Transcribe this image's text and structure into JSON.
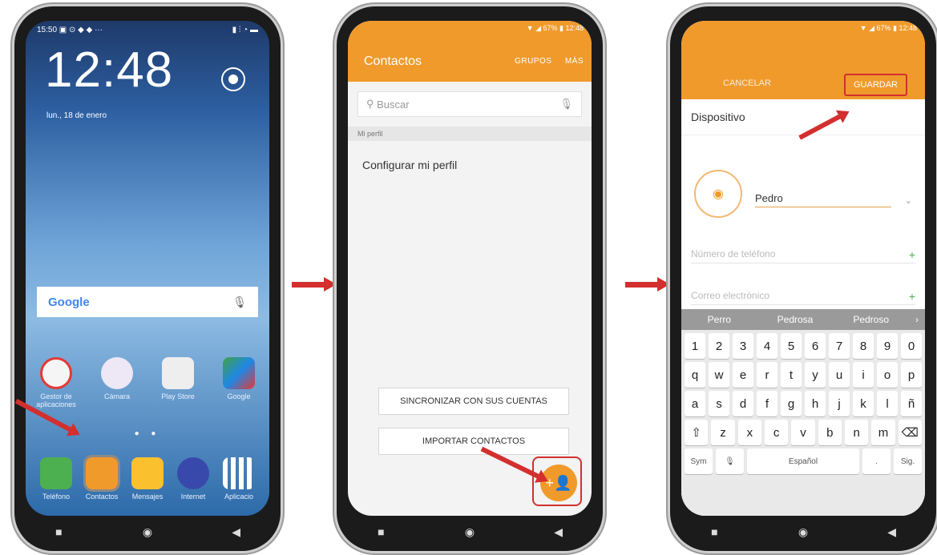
{
  "phone1": {
    "status_left": "15:50 ▣ ⊙ ◆ ◆ ···",
    "status_right": "▮ ⫶ ◔ ▬",
    "clock": "12:48",
    "date": "lun., 18 de enero",
    "search_brand": "Google",
    "apps_row1": [
      {
        "label": "Gestor de aplicaciones",
        "icon": "settings-red-icon",
        "color": "#e53935"
      },
      {
        "label": "Cámara",
        "icon": "camera-icon",
        "color": "#7e57c2"
      },
      {
        "label": "Play Store",
        "icon": "play-store-icon",
        "color": "#e0e0e0"
      },
      {
        "label": "Google",
        "icon": "google-folder-icon",
        "color": "#43a047"
      }
    ],
    "apps_row2": [
      {
        "label": "Teléfono",
        "icon": "phone-icon",
        "color": "#4caf50"
      },
      {
        "label": "Contactos",
        "icon": "contacts-icon",
        "color": "#f09a2c"
      },
      {
        "label": "Mensajes",
        "icon": "messages-icon",
        "color": "#fbc02d"
      },
      {
        "label": "Internet",
        "icon": "internet-icon",
        "color": "#3949ab"
      },
      {
        "label": "Aplicacio",
        "icon": "apps-grid-icon",
        "color": "#ffffff"
      }
    ]
  },
  "phone2": {
    "status": "▼ ◢ 67% ▮ 12:48",
    "title": "Contactos",
    "action_groups": "GRUPOS",
    "action_more": "MÁS",
    "search_placeholder": "Buscar",
    "section_label": "Mi perfil",
    "profile_row": "Configurar mi perfil",
    "sync_button": "SINCRONIZAR CON SUS CUENTAS",
    "import_button": "IMPORTAR CONTACTOS"
  },
  "phone3": {
    "status": "▼ ◢ 67% ▮ 12:48",
    "cancel": "CANCELAR",
    "save": "GUARDAR",
    "device_label": "Dispositivo",
    "name_value": "Pedro",
    "phone_placeholder": "Número de teléfono",
    "email_placeholder": "Correo electrónico",
    "suggestions": [
      "Perro",
      "Pedrosa",
      "Pedroso",
      "›"
    ],
    "keys_numbers": [
      "1",
      "2",
      "3",
      "4",
      "5",
      "6",
      "7",
      "8",
      "9",
      "0"
    ],
    "keys_row1": [
      "q",
      "w",
      "e",
      "r",
      "t",
      "y",
      "u",
      "i",
      "o",
      "p"
    ],
    "keys_row2": [
      "a",
      "s",
      "d",
      "f",
      "g",
      "h",
      "j",
      "k",
      "l",
      "ñ"
    ],
    "keys_row3": [
      "⇧",
      "z",
      "x",
      "c",
      "v",
      "b",
      "n",
      "m",
      "⌫"
    ],
    "key_sym": "Sym",
    "key_space": "Español",
    "key_next": "Sig."
  },
  "colors": {
    "accent": "#f09a2c",
    "highlight": "#d32f2f"
  }
}
